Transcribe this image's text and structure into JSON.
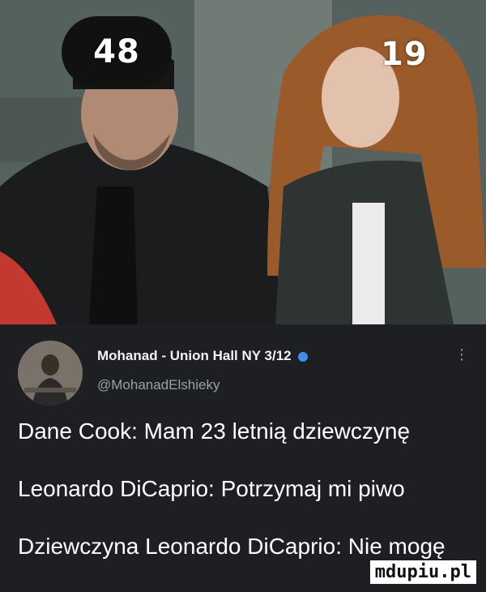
{
  "photo": {
    "age_left": "48",
    "age_right": "19"
  },
  "tweet": {
    "author": "Mohanad - Union Hall NY 3/12",
    "handle": "@MohanadElshieky",
    "more_icon": "more-vertical-icon",
    "lines": [
      "Dane Cook: Mam 23 letnią dziewczynę",
      "Leonardo DiCaprio: Potrzymaj mi piwo",
      "Dziewczyna Leonardo DiCaprio: Nie mogę"
    ]
  },
  "watermark": "mdupiu.pl",
  "colors": {
    "background": "#1e1f22",
    "handle": "#9aa0a6",
    "verified": "#3d8ef0"
  }
}
